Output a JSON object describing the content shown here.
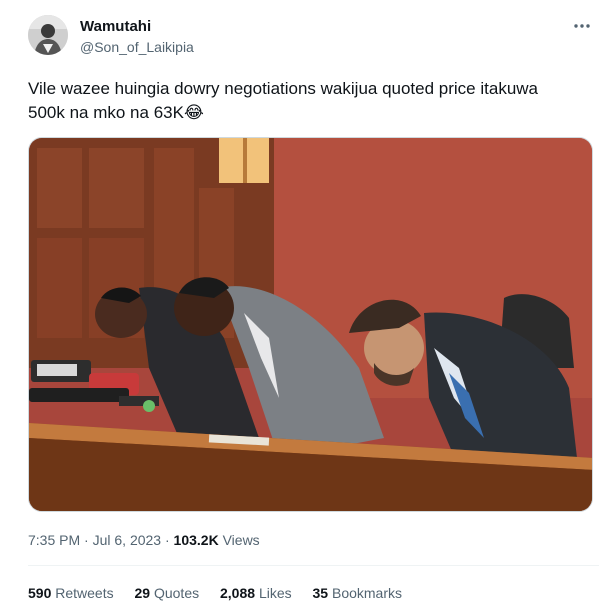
{
  "author": {
    "display_name": "Wamutahi",
    "handle": "@Son_of_Laikipia"
  },
  "more_icon": "more-horizontal-icon",
  "tweet": {
    "text": "Vile wazee huingia dowry negotiations wakijua quoted price itakuwa 500k na mko na 63K",
    "emoji": "😂"
  },
  "media": {
    "kind": "photo"
  },
  "meta": {
    "time": "7:35 PM",
    "separator": "·",
    "date": "Jul 6, 2023",
    "views_count": "103.2K",
    "views_label": "Views"
  },
  "stats": {
    "retweets_count": "590",
    "retweets_label": "Retweets",
    "quotes_count": "29",
    "quotes_label": "Quotes",
    "likes_count": "2,088",
    "likes_label": "Likes",
    "bookmarks_count": "35",
    "bookmarks_label": "Bookmarks"
  },
  "colors": {
    "text_primary": "#0f1419",
    "text_secondary": "#536471",
    "border": "#cfd9de",
    "divider": "#eff3f4"
  }
}
